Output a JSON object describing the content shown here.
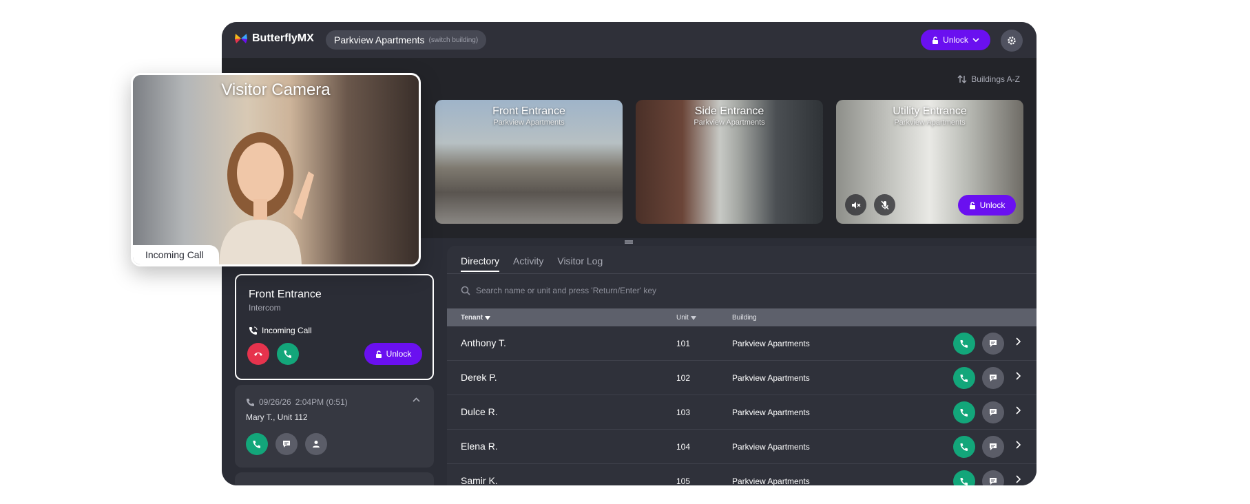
{
  "topbar": {
    "logo": "ButterflyMX",
    "building_name": "Parkview Apartments",
    "switch_label": "(switch building)",
    "unlock_label": "Unlock"
  },
  "cameras": {
    "sort_label": "Buildings A-Z",
    "items": [
      {
        "title": "Front Entrance",
        "subtitle": "Parkview Apartments"
      },
      {
        "title": "Side Entrance",
        "subtitle": "Parkview Apartments"
      },
      {
        "title": "Utility Entrance",
        "subtitle": "Parkview Apartments",
        "unlock_label": "Unlock"
      }
    ]
  },
  "visitor_camera": {
    "title": "Visitor Camera",
    "tag": "Incoming Call"
  },
  "call_card": {
    "title": "Front Entrance",
    "subtitle": "Intercom",
    "status": "Incoming Call",
    "unlock_label": "Unlock"
  },
  "history": {
    "date": "09/26/26",
    "time": "2:04PM (0:51)",
    "who": "Mary T., Unit 112"
  },
  "directory": {
    "tabs": [
      "Directory",
      "Activity",
      "Visitor Log"
    ],
    "search_placeholder": "Search name or unit and press 'Return/Enter' key",
    "headers": {
      "tenant": "Tenant",
      "unit": "Unit",
      "building": "Building"
    },
    "rows": [
      {
        "name": "Anthony T.",
        "unit": "101",
        "building": "Parkview Apartments"
      },
      {
        "name": "Derek P.",
        "unit": "102",
        "building": "Parkview Apartments"
      },
      {
        "name": "Dulce R.",
        "unit": "103",
        "building": "Parkview Apartments"
      },
      {
        "name": "Elena R.",
        "unit": "104",
        "building": "Parkview Apartments"
      },
      {
        "name": "Samir K.",
        "unit": "105",
        "building": "Parkview Apartments"
      }
    ]
  },
  "colors": {
    "accent": "#6a10f0",
    "call_green": "#13a67a",
    "decline_red": "#e6334d",
    "panel": "#2b2d36"
  }
}
